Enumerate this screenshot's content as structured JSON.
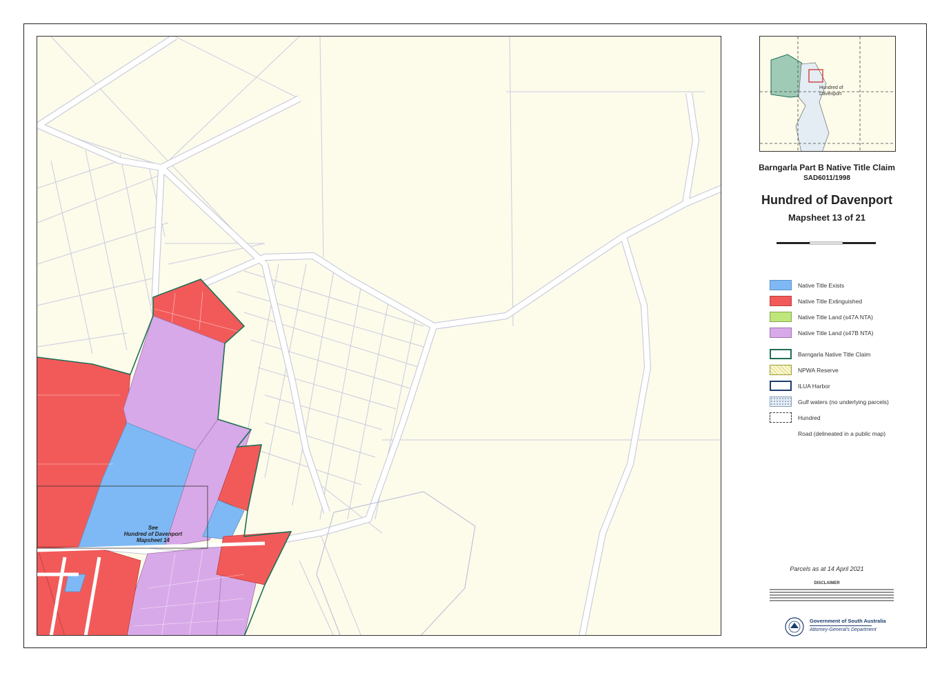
{
  "panel": {
    "claim_title": "Barngarla Part B Native Title Claim",
    "claim_id": "SAD6011/1998",
    "hundred_title": "Hundred of Davenport",
    "mapsheet": "Mapsheet 13 of 21",
    "inset_label": "Hundred of Davenport",
    "parcels_date": "Parcels as at 14 April 2021",
    "disclaimer_heading": "DISCLAIMER",
    "gov_name": "Government of South Australia",
    "gov_dept": "Attorney-General's Department"
  },
  "map": {
    "see_note": [
      "See",
      "Hundred of Davenport",
      "Mapsheet 14"
    ]
  },
  "legend": [
    {
      "label": "Native Title Exists",
      "fill": "#7eb9f5",
      "border": "#5a8fc4",
      "icon": "fill-swatch"
    },
    {
      "label": "Native Title Extinguished",
      "fill": "#f25a5a",
      "border": "#b93c3c",
      "icon": "fill-swatch"
    },
    {
      "label": "Native Title Land (s47A NTA)",
      "fill": "#bfe67a",
      "border": "#86a54e",
      "icon": "fill-swatch"
    },
    {
      "label": "Native Title Land (s47B NTA)",
      "fill": "#d8a9e8",
      "border": "#9e73ad",
      "icon": "fill-swatch"
    },
    {
      "label": "Barngarla Native Title Claim",
      "fill": "#ffffff",
      "border": "#1d6e55",
      "icon": "outline-swatch"
    },
    {
      "label": "NPWA Reserve",
      "fill": "#fbf7d2",
      "border": "#9a9a2e",
      "icon": "hatched-swatch"
    },
    {
      "label": "ILUA Harbor",
      "fill": "#ffffff",
      "border": "#1d3c6e",
      "icon": "outline-swatch"
    },
    {
      "label": "Gulf waters (no underlying parcels)",
      "fill": "#e6eef6",
      "border": "#8aa0b8",
      "icon": "dotted-swatch"
    },
    {
      "label": "Hundred",
      "fill": "none",
      "border": "#333333",
      "icon": "dashed-swatch"
    },
    {
      "label": "Road (delineated in a public map)",
      "fill": "#ffffff",
      "border": "#ffffff",
      "icon": "road-swatch"
    }
  ],
  "colors": {
    "background": "#fdfbea",
    "road": "#ffffff",
    "parcel_line": "#b8bedc",
    "claim_boundary": "#1d6e55"
  }
}
